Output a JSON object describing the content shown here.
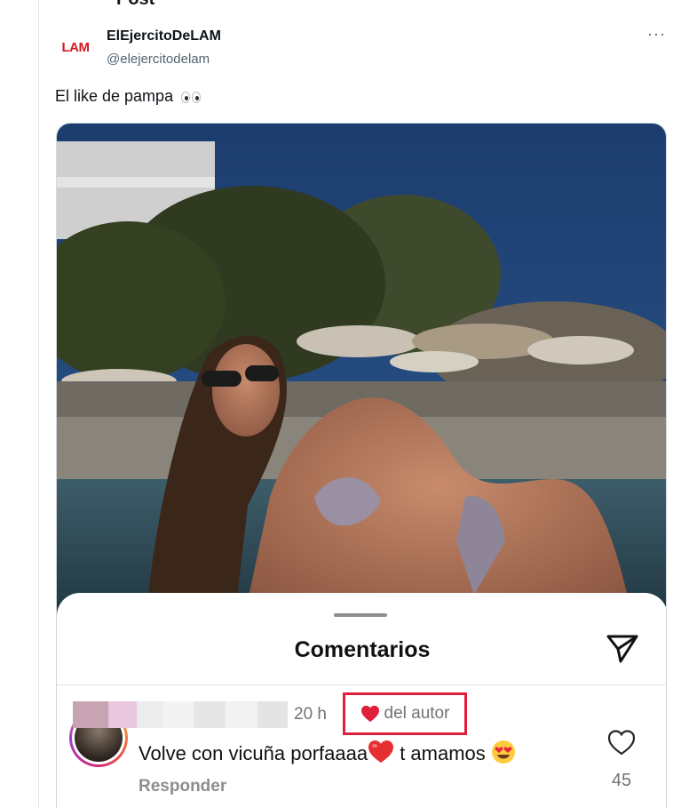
{
  "page": {
    "header_partial": "Post"
  },
  "post": {
    "display_name": "ElEjercitoDeLAM",
    "handle": "@elejercitodelam",
    "avatar_logo": "LAM",
    "more_label": "···",
    "text": "El like de pampa",
    "text_emoji": "eyes-emoji"
  },
  "comments_sheet": {
    "title": "Comentarios",
    "send_icon": "paper-plane-icon",
    "comment": {
      "time": "20 h",
      "author_badge": "del autor",
      "text_part1": "Volve con vicuña porfaaaa",
      "text_part2": " t amamos",
      "reply_label": "Responder",
      "like_count": "45"
    }
  },
  "colors": {
    "brand_red": "#d6181f",
    "highlight_box": "#e0203a",
    "heart_red": "#e0203a",
    "handle_gray": "#536471"
  }
}
